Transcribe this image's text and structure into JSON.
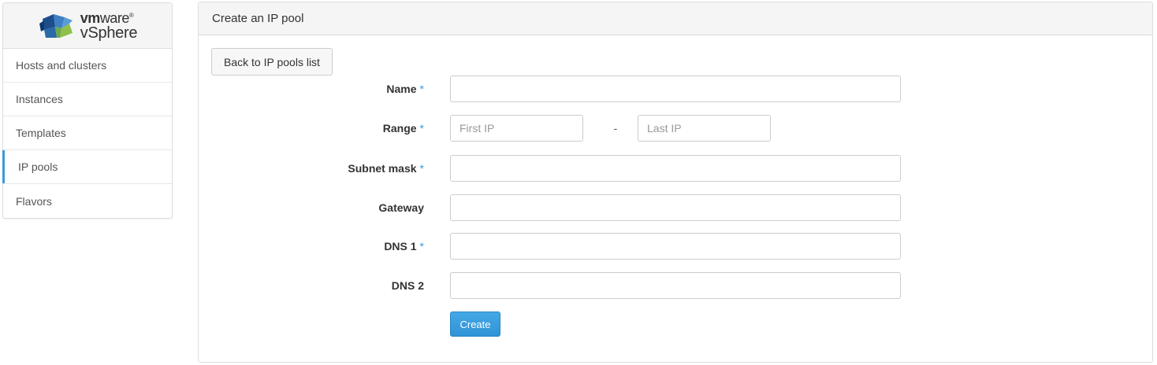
{
  "brand": {
    "vm_bold": "vm",
    "vm_light": "ware",
    "reg": "®",
    "product": "vSphere"
  },
  "sidebar": {
    "items": [
      {
        "label": "Hosts and clusters"
      },
      {
        "label": "Instances"
      },
      {
        "label": "Templates"
      },
      {
        "label": "IP pools",
        "active": true
      },
      {
        "label": "Flavors"
      }
    ],
    "accent_color": "#3a9ad9"
  },
  "panel": {
    "title": "Create an IP pool",
    "back_button": "Back to IP pools list"
  },
  "form": {
    "required_marker": "*",
    "name": {
      "label": "Name",
      "value": ""
    },
    "range": {
      "label": "Range",
      "first_placeholder": "First IP",
      "separator": "-",
      "last_placeholder": "Last IP"
    },
    "subnet_mask": {
      "label": "Subnet mask",
      "value": ""
    },
    "gateway": {
      "label": "Gateway",
      "value": ""
    },
    "dns1": {
      "label": "DNS 1",
      "value": ""
    },
    "dns2": {
      "label": "DNS 2",
      "value": ""
    },
    "submit": "Create"
  },
  "colors": {
    "primary_button": "#3a9ad9",
    "panel_heading_bg": "#f5f5f5",
    "border": "#dddddd"
  }
}
